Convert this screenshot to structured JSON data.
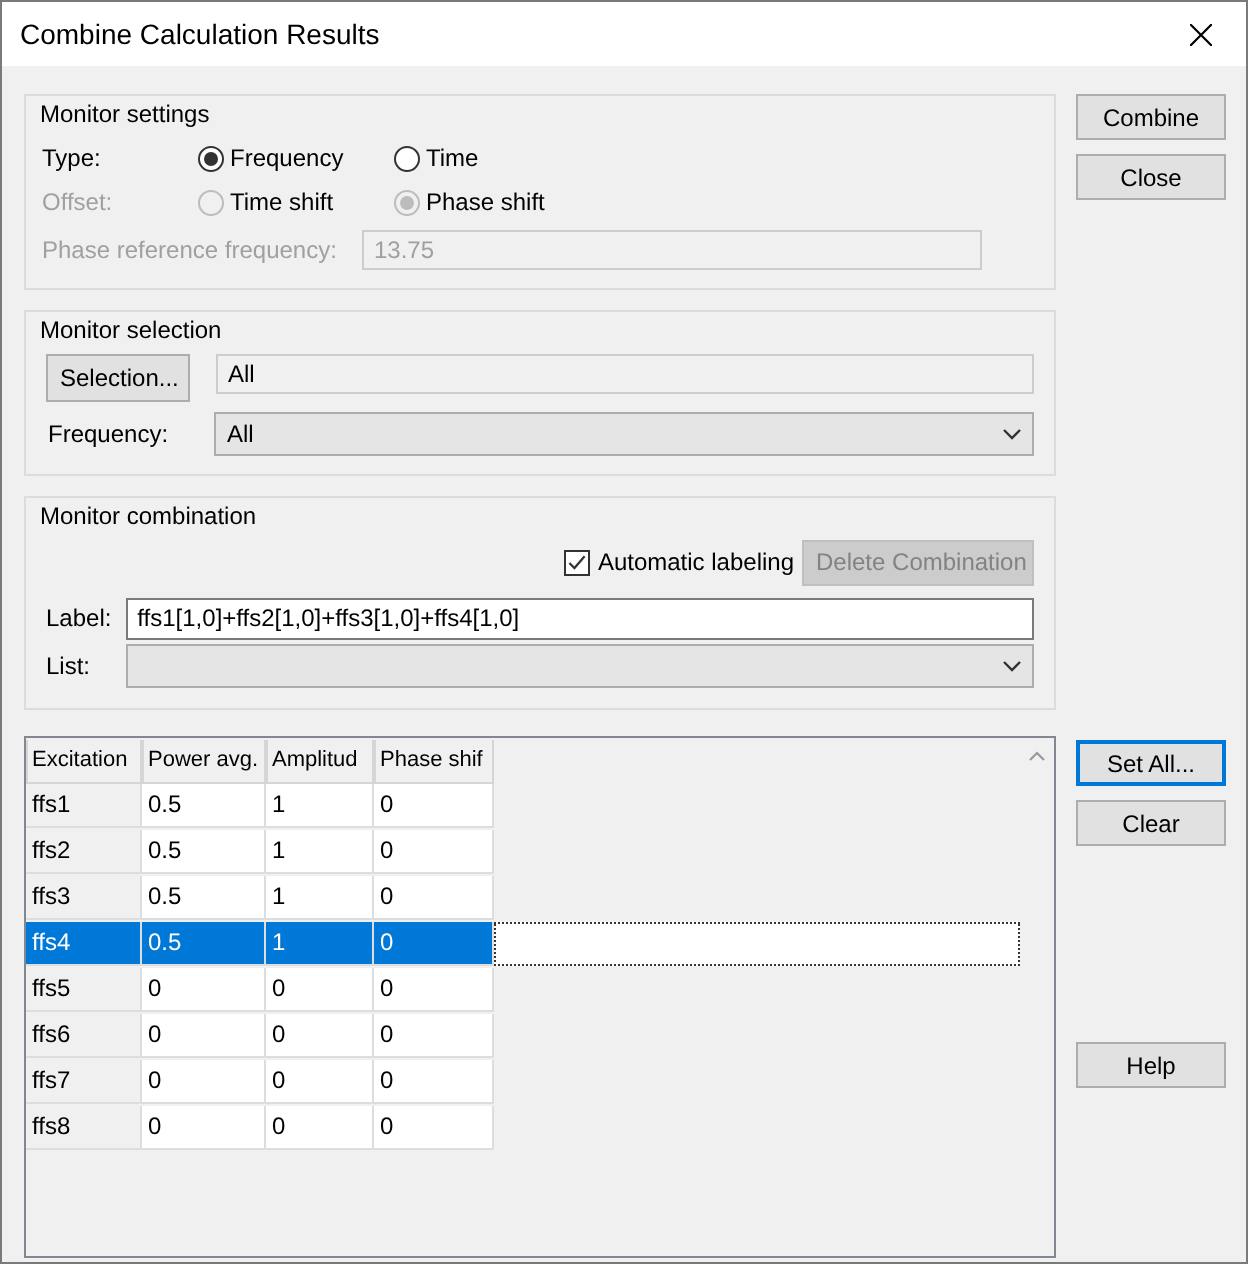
{
  "window": {
    "title": "Combine Calculation Results"
  },
  "monitor_settings": {
    "title": "Monitor settings",
    "type": {
      "label": "Type:",
      "disabled": false,
      "options": [
        {
          "label": "Frequency",
          "selected": true
        },
        {
          "label": "Time",
          "selected": false
        }
      ]
    },
    "offset": {
      "label": "Offset:",
      "disabled": true,
      "options": [
        {
          "label": "Time shift",
          "selected": false
        },
        {
          "label": "Phase shift",
          "selected": true
        }
      ]
    },
    "phase_reference_frequency": {
      "label": "Phase reference frequency:",
      "value": "13.75",
      "disabled": true
    }
  },
  "monitor_selection": {
    "title": "Monitor selection",
    "selection_button": "Selection...",
    "selection_value": "All",
    "frequency": {
      "label": "Frequency:",
      "value": "All"
    }
  },
  "monitor_combination": {
    "title": "Monitor combination",
    "automatic_labeling": {
      "label": "Automatic labeling",
      "checked": true
    },
    "delete_button": {
      "label": "Delete Combination",
      "disabled": true
    },
    "label_field": {
      "label": "Label:",
      "value": "ffs1[1,0]+ffs2[1,0]+ffs3[1,0]+ffs4[1,0]"
    },
    "list_field": {
      "label": "List:"
    }
  },
  "table": {
    "columns": [
      "Excitation",
      "Power avg.",
      "Amplitud",
      "Phase shif"
    ],
    "rows": [
      {
        "cells": [
          "ffs1",
          "0.5",
          "1",
          "0"
        ],
        "selected": false
      },
      {
        "cells": [
          "ffs2",
          "0.5",
          "1",
          "0"
        ],
        "selected": false
      },
      {
        "cells": [
          "ffs3",
          "0.5",
          "1",
          "0"
        ],
        "selected": false
      },
      {
        "cells": [
          "ffs4",
          "0.5",
          "1",
          "0"
        ],
        "selected": true
      },
      {
        "cells": [
          "ffs5",
          "0",
          "0",
          "0"
        ],
        "selected": false
      },
      {
        "cells": [
          "ffs6",
          "0",
          "0",
          "0"
        ],
        "selected": false
      },
      {
        "cells": [
          "ffs7",
          "0",
          "0",
          "0"
        ],
        "selected": false
      },
      {
        "cells": [
          "ffs8",
          "0",
          "0",
          "0"
        ],
        "selected": false
      }
    ]
  },
  "buttons_top": [
    {
      "label": "Combine",
      "focused": false
    },
    {
      "label": "Close",
      "focused": false
    }
  ],
  "buttons_table": [
    {
      "label": "Set All...",
      "focused": true
    },
    {
      "label": "Clear",
      "focused": false
    }
  ],
  "help_button": {
    "label": "Help"
  }
}
